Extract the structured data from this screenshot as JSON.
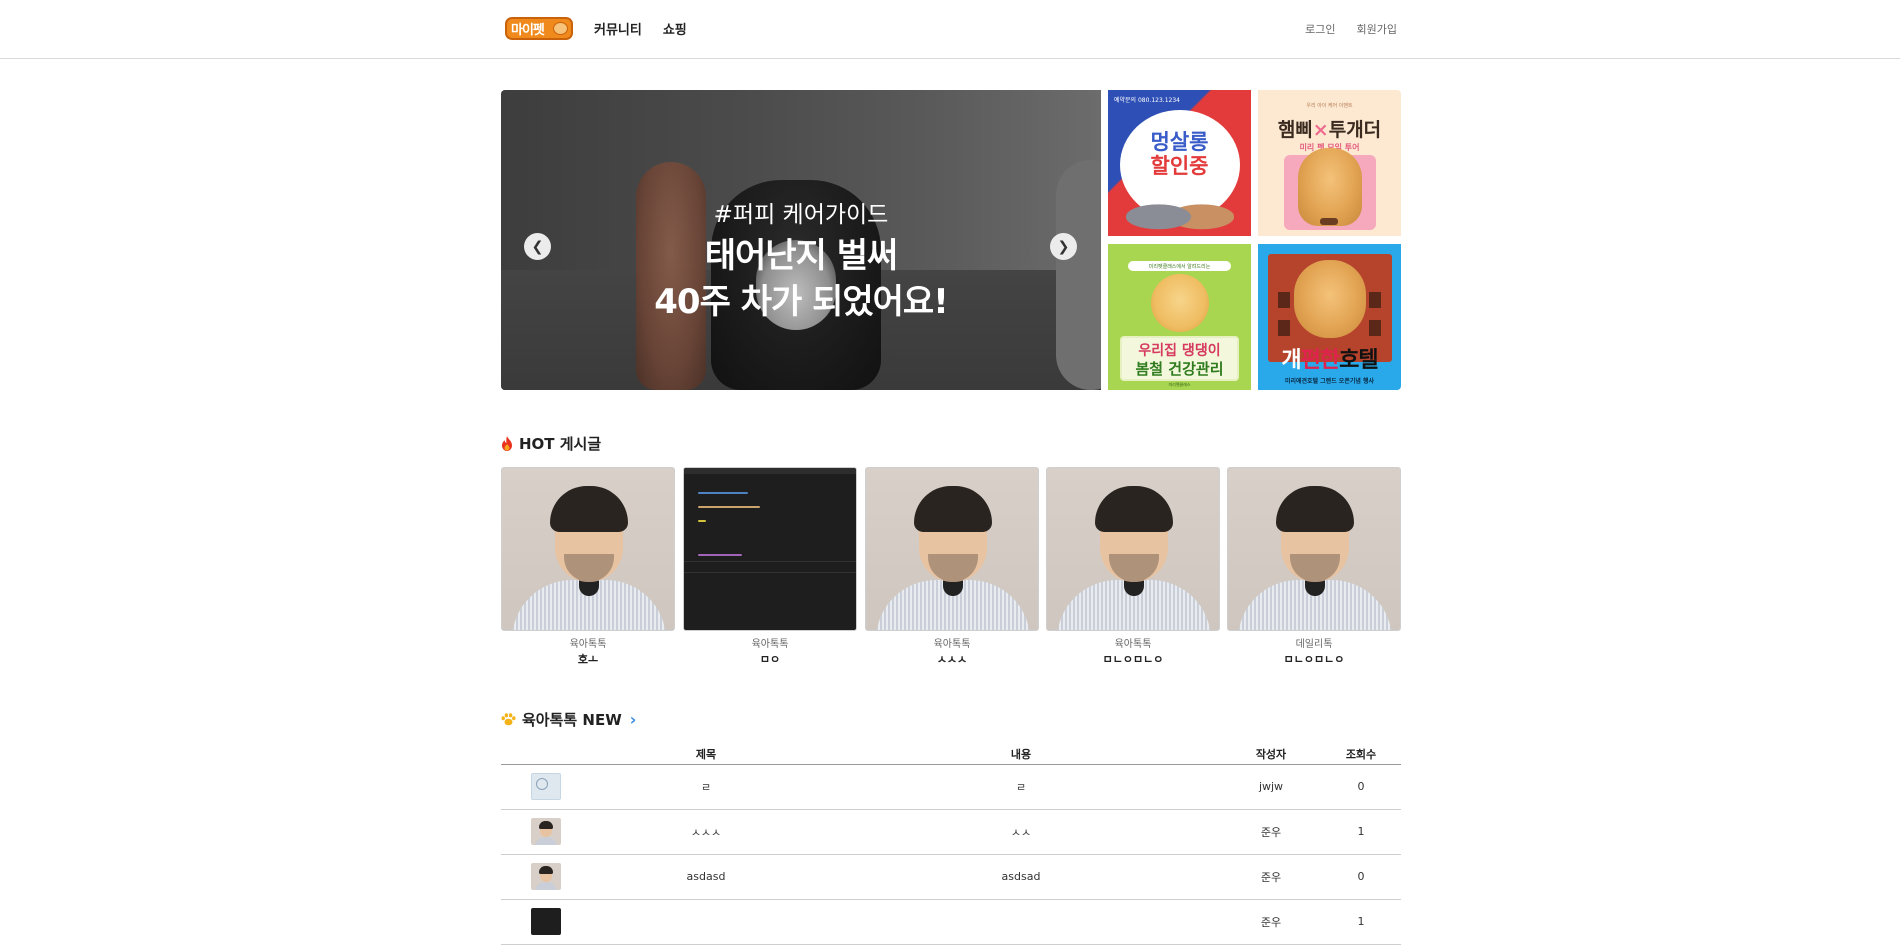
{
  "header": {
    "logo_text": "마이펫",
    "nav": [
      "커뮤니티",
      "쇼핑"
    ],
    "login": "로그인",
    "signup": "회원가입"
  },
  "hero": {
    "subtitle": "#퍼피 케어가이드",
    "title_line1": "태어난지 벌써",
    "title_line2": "40주 차가 되었어요!",
    "prev_icon": "chevron-left-icon",
    "next_icon": "chevron-right-icon"
  },
  "banners": {
    "b1": {
      "tag": "예약문의 080.123.1234",
      "line1": "멍살롱",
      "line2": "할인중"
    },
    "b2": {
      "tag": "우리 아이 케어 이벤트",
      "brand_a": "햄삐",
      "x": "×",
      "brand_b": "투개더",
      "sub": "미리 펫 모임 투어"
    },
    "b3": {
      "tag": "미리펫클래스에서 알려드리는",
      "line1": "우리집 댕댕이",
      "line2": "봄철 건강관리",
      "foot": "미리펫클래스"
    },
    "b4": {
      "t_a": "개",
      "t_b": "편한",
      "t_c": "호텔",
      "foot": "미리애견호텔 그랜드 오픈기념 행사"
    }
  },
  "hot": {
    "title": "HOT 게시글",
    "icon": "fire-icon",
    "cards": [
      {
        "category": "육아톡톡",
        "title": "호ㅗ",
        "image": "portrait"
      },
      {
        "category": "육아톡톡",
        "title": "ㅁㅇ",
        "image": "code"
      },
      {
        "category": "육아톡톡",
        "title": "ㅅㅅㅅ",
        "image": "portrait"
      },
      {
        "category": "육아톡톡",
        "title": "ㅁㄴㅇㅁㄴㅇ",
        "image": "portrait"
      },
      {
        "category": "데일리톡",
        "title": "ㅁㄴㅇㅁㄴㅇ",
        "image": "portrait"
      }
    ]
  },
  "newsec": {
    "title": "육아톡톡 NEW",
    "icon": "paw-icon",
    "more_icon": "chevron-right-icon",
    "columns": [
      "제목",
      "내용",
      "작성자",
      "조회수"
    ],
    "rows": [
      {
        "thumb": "map",
        "title": "ㄹ",
        "content": "ㄹ",
        "author": "jwjw",
        "views": "0"
      },
      {
        "thumb": "face",
        "title": "ㅅㅅㅅ",
        "content": "ㅅㅅ",
        "author": "준우",
        "views": "1"
      },
      {
        "thumb": "face",
        "title": "asdasd",
        "content": "asdsad",
        "author": "준우",
        "views": "0"
      },
      {
        "thumb": "dark",
        "title": "",
        "content": "",
        "author": "준우",
        "views": "1"
      }
    ]
  },
  "colors": {
    "accent": "#f08a1c",
    "link": "#3d8de0",
    "views": "#c0392b"
  }
}
